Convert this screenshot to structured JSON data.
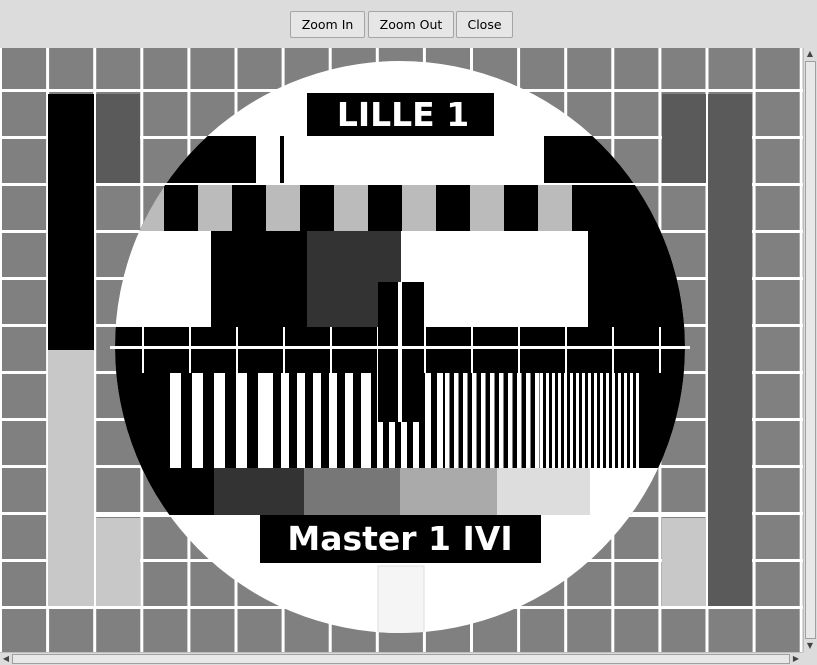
{
  "toolbar": {
    "zoom_in_label": "Zoom In",
    "zoom_out_label": "Zoom Out",
    "close_label": "Close"
  },
  "image": {
    "top_caption": "LILLE 1",
    "bottom_caption": "Master 1 IVI"
  },
  "scrollbars": {
    "up_arrow": "▲",
    "down_arrow": "▼",
    "left_arrow": "◀",
    "right_arrow": "▶"
  },
  "colors": {
    "grid_background": "#808080",
    "grid_lines": "#ffffff",
    "black": "#000000",
    "white": "#ffffff"
  }
}
